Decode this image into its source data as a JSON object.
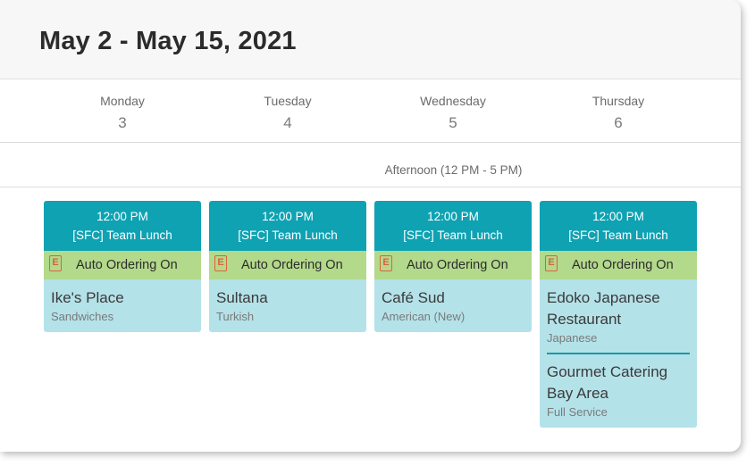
{
  "header": {
    "title": "May 2 - May 15, 2021"
  },
  "days": [
    {
      "name": "Monday",
      "number": "3"
    },
    {
      "name": "Tuesday",
      "number": "4"
    },
    {
      "name": "Wednesday",
      "number": "5"
    },
    {
      "name": "Thursday",
      "number": "6"
    }
  ],
  "period_label": "Afternoon (12 PM - 5 PM)",
  "events": [
    {
      "time": "12:00 PM",
      "name": "[SFC] Team Lunch",
      "auto_label": "Auto Ordering On",
      "restaurants": [
        {
          "name": "Ike's Place",
          "cuisine": "Sandwiches"
        }
      ]
    },
    {
      "time": "12:00 PM",
      "name": "[SFC] Team Lunch",
      "auto_label": "Auto Ordering On",
      "restaurants": [
        {
          "name": "Sultana",
          "cuisine": "Turkish"
        }
      ]
    },
    {
      "time": "12:00 PM",
      "name": "[SFC] Team Lunch",
      "auto_label": "Auto Ordering On",
      "restaurants": [
        {
          "name": "Café Sud",
          "cuisine": "American (New)"
        }
      ]
    },
    {
      "time": "12:00 PM",
      "name": "[SFC] Team Lunch",
      "auto_label": "Auto Ordering On",
      "restaurants": [
        {
          "name": "Edoko Japanese Restaurant",
          "cuisine": "Japanese"
        },
        {
          "name": "Gourmet Catering Bay Area",
          "cuisine": "Full Service"
        }
      ]
    }
  ],
  "auto_icon_glyph": "E",
  "colors": {
    "event_header": "#0fa2b3",
    "auto_ordering": "#b3d98b",
    "event_body": "#b4e2e9",
    "auto_icon": "#e0603a"
  }
}
